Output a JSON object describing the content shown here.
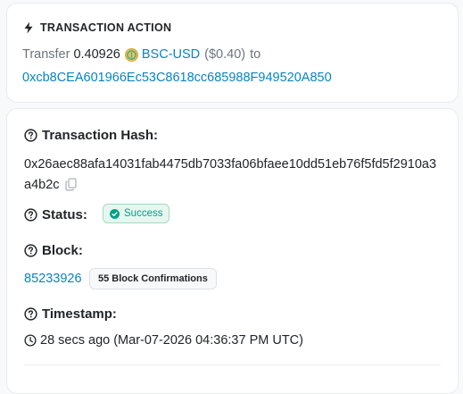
{
  "action": {
    "header": "TRANSACTION ACTION",
    "verb": "Transfer",
    "amount": "0.40926",
    "token": "BSC-USD",
    "usd_value": "($0.40)",
    "to_word": "to",
    "to_address": "0xcb8CEA601966Ec53C8618cc685988F949520A850",
    "icon": "lightning-icon",
    "token_icon": "token-coin-icon"
  },
  "details": {
    "hash_label": "Transaction Hash:",
    "hash_value": "0x26aec88afa14031fab4475db7033fa06bfaee10dd51eb76f5fd5f2910a3a4b2c",
    "status_label": "Status:",
    "status_value": "Success",
    "block_label": "Block:",
    "block_number": "85233926",
    "block_confirmations": "55 Block Confirmations",
    "timestamp_label": "Timestamp:",
    "timestamp_value": "28 secs ago (Mar-07-2026 04:36:37 PM UTC)"
  },
  "colors": {
    "link": "#0784c3",
    "success": "#00a186",
    "text": "#212529",
    "muted": "#6c757d"
  }
}
